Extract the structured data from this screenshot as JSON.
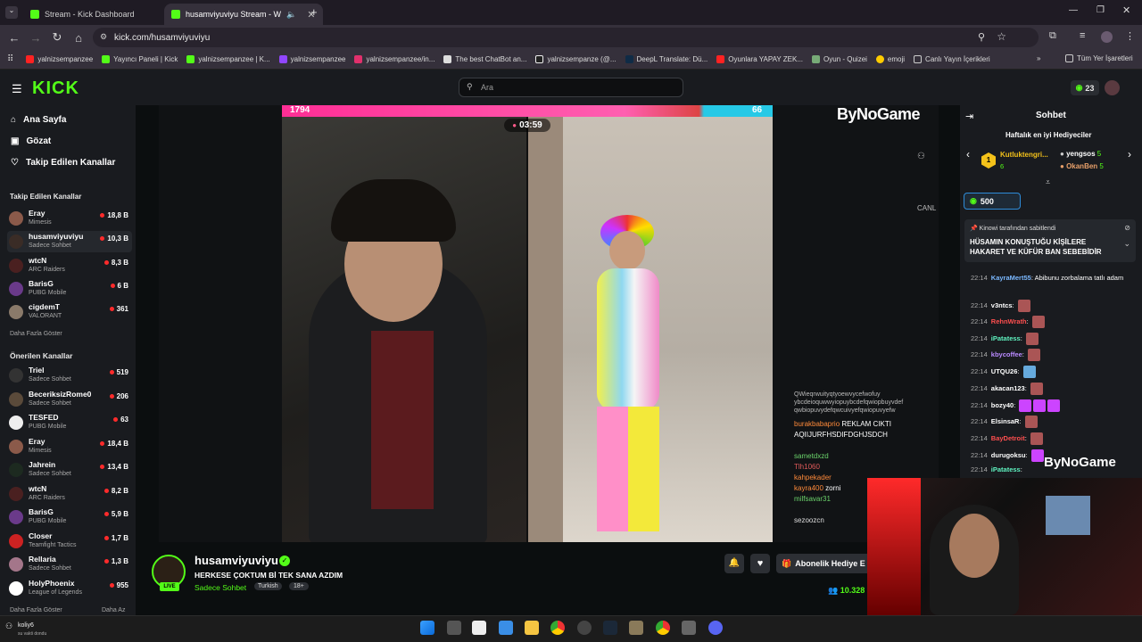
{
  "browser": {
    "tabs": [
      {
        "title": "Stream - Kick Dashboard"
      },
      {
        "title": "husamviyuviyu Stream - W"
      }
    ],
    "url": "kick.com/husamviyuviyu",
    "bookmarks": [
      "yalnizsempanzee",
      "Yayıncı Paneli | Kick",
      "yalnizsempanzee | K...",
      "yalnizsempanzee",
      "yalnizsempanzee/in...",
      "The best ChatBot an...",
      "yalnizsempanze (@...",
      "DeepL Translate: Dü...",
      "Oyunlara YAPAY ZEK...",
      "Oyun - Quizei",
      "emoji",
      "Canlı Yayın İçerikleri"
    ],
    "all_bookmarks": "Tüm Yer İşaretleri"
  },
  "header": {
    "logo": "KICK",
    "search_placeholder": "Ara",
    "points": "23"
  },
  "sidebar": {
    "nav": [
      "Ana Sayfa",
      "Gözat",
      "Takip Edilen Kanallar"
    ],
    "followed_title": "Takip Edilen Kanallar",
    "followed": [
      {
        "name": "Eray",
        "cat": "Mimesis",
        "viewers": "18,8 B"
      },
      {
        "name": "husamviyuviyu",
        "cat": "Sadece Sohbet",
        "viewers": "10,3 B"
      },
      {
        "name": "wtcN",
        "cat": "ARC Raiders",
        "viewers": "8,3 B"
      },
      {
        "name": "BarisG",
        "cat": "PUBG Mobile",
        "viewers": "6 B"
      },
      {
        "name": "cigdemT",
        "cat": "VALORANT",
        "viewers": "361"
      }
    ],
    "show_more": "Daha Fazla Göster",
    "recommended_title": "Önerilen Kanallar",
    "recommended": [
      {
        "name": "Triel",
        "cat": "Sadece Sohbet",
        "viewers": "519"
      },
      {
        "name": "BeceriksizRome0",
        "cat": "Sadece Sohbet",
        "viewers": "206"
      },
      {
        "name": "TESFED",
        "cat": "PUBG Mobile",
        "viewers": "63"
      },
      {
        "name": "Eray",
        "cat": "Mimesis",
        "viewers": "18,4 B"
      },
      {
        "name": "Jahrein",
        "cat": "Sadece Sohbet",
        "viewers": "13,4 B"
      },
      {
        "name": "wtcN",
        "cat": "ARC Raiders",
        "viewers": "8,2 B"
      },
      {
        "name": "BarisG",
        "cat": "PUBG Mobile",
        "viewers": "5,9 B"
      },
      {
        "name": "Closer",
        "cat": "Teamfight Tactics",
        "viewers": "1,7 B"
      },
      {
        "name": "Rellaria",
        "cat": "Sadece Sohbet",
        "viewers": "1,3 B"
      },
      {
        "name": "HolyPhoenix",
        "cat": "League of Legends",
        "viewers": "955"
      }
    ],
    "show_more2": "Daha Fazla Göster",
    "show_less": "Daha Az",
    "user": {
      "name": "koliy6",
      "status": "su vakti dondu"
    }
  },
  "video": {
    "score_left": "1794",
    "score_right": "66",
    "timer": "03:59",
    "brand": "ByNoGame"
  },
  "stream": {
    "channel": "husamviyuviyu",
    "title": "HERKESE ÇOKTUM Bİ TEK SANA AZDIM",
    "category": "Sadece Sohbet",
    "tags": [
      "Turkish",
      "18+"
    ],
    "live": "LIVE",
    "gift_button": "Abonelik Hediye E",
    "viewers": "10.328"
  },
  "overlay_chat": [
    {
      "user": "burakbabaprio",
      "text": "REKLAM CIKTI AQIIJURFHSDIFDGHJSDCH"
    },
    {
      "user": "sametdxzd",
      "text": ""
    },
    {
      "user": "Tlh1060",
      "text": ""
    },
    {
      "user": "kahpekader",
      "text": ""
    },
    {
      "user": "kayra400",
      "text": "zorni"
    },
    {
      "user": "milfsavar31",
      "text": ""
    },
    {
      "user": "sezoozcn",
      "text": ""
    }
  ],
  "chat": {
    "title": "Sohbet",
    "leaders_title": "Haftalık en iyi Hediyeciler",
    "leaders": [
      {
        "name": "Kutluktengri...",
        "count": "6"
      },
      {
        "name": "yengsos",
        "count": "5"
      },
      {
        "name": "OkanBen",
        "count": "5"
      }
    ],
    "goal": "500",
    "pinned_by": "Kinowi tarafından sabitlendi",
    "pinned_text": "HÜSAMIN KONUŞTUĞU KİŞİLERE HAKARET VE KÜFÜR BAN SEBEBİDİR",
    "messages": [
      {
        "time": "22:14",
        "user": "KayraMert55",
        "text": "Abibunu zorbalama tatlı adam",
        "color": "#7ab8ff"
      },
      {
        "time": "22:14",
        "user": "v3ntcs",
        "text": "",
        "color": "#ffffff"
      },
      {
        "time": "22:14",
        "user": "RehnWrath",
        "text": "",
        "color": "#ff4f4f"
      },
      {
        "time": "22:14",
        "user": "iPatatess",
        "text": "",
        "color": "#5ff3c0"
      },
      {
        "time": "22:14",
        "user": "kbycoffee",
        "text": "",
        "color": "#b98aff"
      },
      {
        "time": "22:14",
        "user": "UTQU26",
        "text": "",
        "color": "#ffffff"
      },
      {
        "time": "22:14",
        "user": "akacan123",
        "text": "",
        "color": "#ffffff"
      },
      {
        "time": "22:14",
        "user": "bozy40",
        "text": "",
        "color": "#ffffff"
      },
      {
        "time": "22:14",
        "user": "ElsinsaR",
        "text": "",
        "color": "#ffffff"
      },
      {
        "time": "22:14",
        "user": "BayDetroit",
        "text": "",
        "color": "#ff4f4f"
      },
      {
        "time": "22:14",
        "user": "durugoksu",
        "text": "",
        "color": "#ffffff"
      },
      {
        "time": "22:14",
        "user": "iPatatess",
        "text": "",
        "color": "#5ff3c0"
      }
    ]
  },
  "colors": {
    "accent": "#53fc18",
    "live_dot": "#ff2b2b"
  }
}
